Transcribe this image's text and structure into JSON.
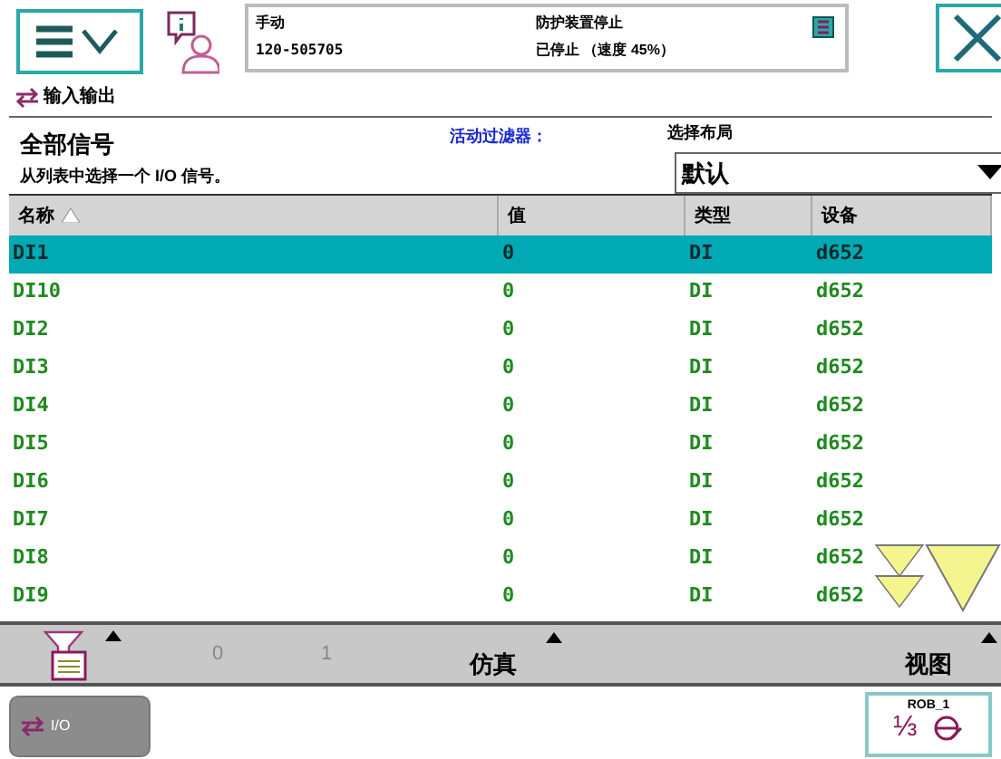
{
  "status": {
    "mode": "手动",
    "system": "120-505705",
    "safety": "防护装置停止",
    "run_state": "已停止 （速度 45%）"
  },
  "app_title": "输入输出",
  "view": {
    "title": "全部信号",
    "instruction": "从列表中选择一个 I/O 信号。",
    "filter_label": "活动过滤器：",
    "layout_label": "选择布局",
    "layout_select": {
      "value": "默认"
    }
  },
  "table": {
    "columns": [
      {
        "label": "名称",
        "sorted": true
      },
      {
        "label": "值",
        "sorted": false
      },
      {
        "label": "类型",
        "sorted": false
      },
      {
        "label": "设备",
        "sorted": false
      }
    ],
    "rows": [
      {
        "cells": [
          "DI1",
          "0",
          "DI",
          "d652"
        ],
        "selected": true
      },
      {
        "cells": [
          "DI10",
          "0",
          "DI",
          "d652"
        ],
        "selected": false
      },
      {
        "cells": [
          "DI2",
          "0",
          "DI",
          "d652"
        ],
        "selected": false
      },
      {
        "cells": [
          "DI3",
          "0",
          "DI",
          "d652"
        ],
        "selected": false
      },
      {
        "cells": [
          "DI4",
          "0",
          "DI",
          "d652"
        ],
        "selected": false
      },
      {
        "cells": [
          "DI5",
          "0",
          "DI",
          "d652"
        ],
        "selected": false
      },
      {
        "cells": [
          "DI6",
          "0",
          "DI",
          "d652"
        ],
        "selected": false
      },
      {
        "cells": [
          "DI7",
          "0",
          "DI",
          "d652"
        ],
        "selected": false
      },
      {
        "cells": [
          "DI8",
          "0",
          "DI",
          "d652"
        ],
        "selected": false
      },
      {
        "cells": [
          "DI9",
          "0",
          "DI",
          "d652"
        ],
        "selected": false
      }
    ]
  },
  "toolbar": [
    {
      "kind": "filter",
      "disabled": false
    },
    {
      "kind": "text",
      "label": "0",
      "disabled": true
    },
    {
      "kind": "text",
      "label": "1",
      "disabled": true
    },
    {
      "kind": "menu",
      "label": "仿真",
      "disabled": false
    },
    {
      "kind": "menu",
      "label": "视图",
      "disabled": false
    }
  ],
  "taskbar": {
    "task": {
      "label": "I/O"
    },
    "robot": "ROB_1",
    "mechanical_units": "⅓"
  }
}
